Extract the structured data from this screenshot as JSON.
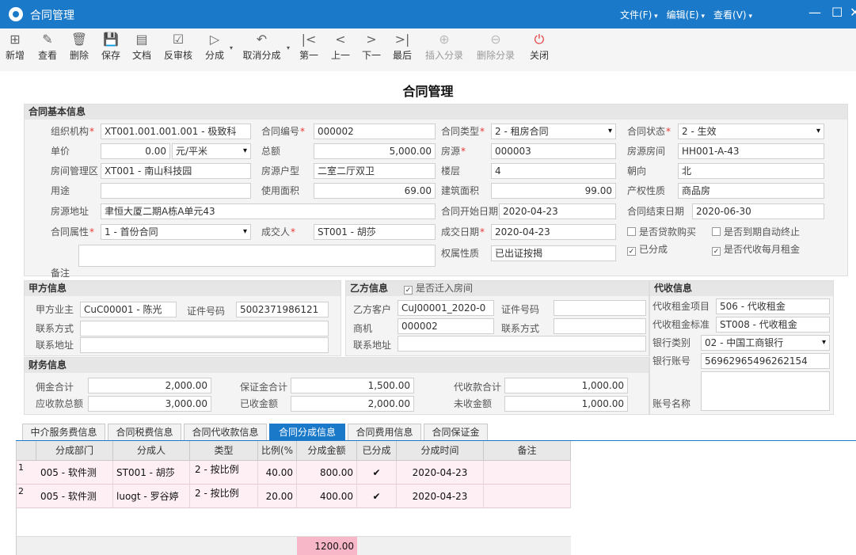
{
  "window": {
    "title": "合同管理",
    "menus": [
      "文件(F)",
      "编辑(E)",
      "查看(V)"
    ]
  },
  "toolbar": {
    "items": [
      "新增",
      "查看",
      "删除",
      "保存",
      "文档",
      "反审核",
      "分成",
      "取消分成",
      "第一",
      "上一",
      "下一",
      "最后",
      "插入分录",
      "删除分录",
      "关闭"
    ]
  },
  "page_title": "合同管理",
  "basic": {
    "title": "合同基本信息",
    "org_label": "组织机构",
    "org_value": "XT001.001.001.001 - 极致科",
    "contract_no_label": "合同编号",
    "contract_no_value": "000002",
    "contract_type_label": "合同类型",
    "contract_type_value": "2 - 租房合同",
    "contract_status_label": "合同状态",
    "contract_status_value": "2 - 生效",
    "unit_price_label": "单价",
    "unit_price_value": "0.00",
    "unit_value": "元/平米",
    "total_label": "总额",
    "total_value": "5,000.00",
    "source_label": "房源",
    "source_value": "000003",
    "room_label": "房源房间",
    "room_value": "HH001-A-43",
    "area_mgmt_label": "房间管理区",
    "area_mgmt_value": "XT001 - 南山科技园",
    "house_type_label": "房源户型",
    "house_type_value": "二室二厅双卫",
    "floor_label": "楼层",
    "floor_value": "4",
    "orientation_label": "朝向",
    "orientation_value": "北",
    "purpose_label": "用途",
    "purpose_value": "",
    "use_area_label": "使用面积",
    "use_area_value": "69.00",
    "build_area_label": "建筑面积",
    "build_area_value": "99.00",
    "property_label": "产权性质",
    "property_value": "商品房",
    "address_label": "房源地址",
    "address_value": "聿恒大厦二期A栋A单元43",
    "start_label": "合同开始日期",
    "start_value": "2020-04-23",
    "end_label": "合同结束日期",
    "end_value": "2020-06-30",
    "attr_label": "合同属性",
    "attr_value": "1 - 首份合同",
    "dealer_label": "成交人",
    "dealer_value": "ST001 - 胡莎",
    "deal_date_label": "成交日期",
    "deal_date_value": "2020-04-23",
    "loan_label": "是否贷款购买",
    "auto_end_label": "是否到期自动终止",
    "remark_label": "备注",
    "remark_value": "",
    "ownership_label": "权属性质",
    "ownership_value": "已出证按揭",
    "split_label": "已分成",
    "collect_rent_label": "是否代收每月租金"
  },
  "party_a": {
    "title": "甲方信息",
    "owner_label": "甲方业主",
    "owner_value": "CuC00001 - 陈光",
    "id_label": "证件号码",
    "id_value": "5002371986121",
    "contact_label": "联系方式",
    "contact_value": "",
    "addr_label": "联系地址",
    "addr_value": ""
  },
  "party_b": {
    "title": "乙方信息",
    "moved_label": "是否迁入房间",
    "customer_label": "乙方客户",
    "customer_value": "CuJ00001_2020-0",
    "id_label": "证件号码",
    "id_value": "",
    "agent_label": "商机",
    "agent_value": "000002",
    "contact_label": "联系方式",
    "contact_value": "",
    "addr_label": "联系地址",
    "addr_value": ""
  },
  "collection": {
    "title": "代收信息",
    "item_label": "代收租金项目",
    "item_value": "506 - 代收租金",
    "std_label": "代收租金标准",
    "std_value": "ST008 - 代收租金",
    "bank_type_label": "银行类别",
    "bank_type_value": "02 - 中国工商银行",
    "bank_acct_label": "银行账号",
    "bank_acct_value": "56962965496262154",
    "acct_name_label": "账号名称",
    "acct_name_value": ""
  },
  "finance": {
    "title": "财务信息",
    "commission_label": "佣金合计",
    "commission_value": "2,000.00",
    "deposit_label": "保证金合计",
    "deposit_value": "1,500.00",
    "proxy_label": "代收款合计",
    "proxy_value": "1,000.00",
    "receivable_label": "应收款总额",
    "receivable_value": "3,000.00",
    "received_label": "已收金额",
    "received_value": "2,000.00",
    "unreceived_label": "未收金额",
    "unreceived_value": "1,000.00"
  },
  "tabs": [
    "中介服务费信息",
    "合同税费信息",
    "合同代收款信息",
    "合同分成信息",
    "合同费用信息",
    "合同保证金"
  ],
  "grid": {
    "columns": [
      "分成部门",
      "分成人",
      "类型",
      "比例(%",
      "分成金额",
      "已分成",
      "分成时间",
      "备注"
    ],
    "rows": [
      {
        "n": "1",
        "dept": "005 - 软件测",
        "person": "ST001 - 胡莎",
        "type": "2 - 按比例",
        "ratio": "40.00",
        "amount": "800.00",
        "split": "✔",
        "time": "2020-04-23",
        "remark": ""
      },
      {
        "n": "2",
        "dept": "005 - 软件测",
        "person": "luogt - 罗谷婷",
        "type": "2 - 按比例",
        "ratio": "20.00",
        "amount": "400.00",
        "split": "✔",
        "time": "2020-04-23",
        "remark": ""
      }
    ],
    "total": "1200.00"
  }
}
